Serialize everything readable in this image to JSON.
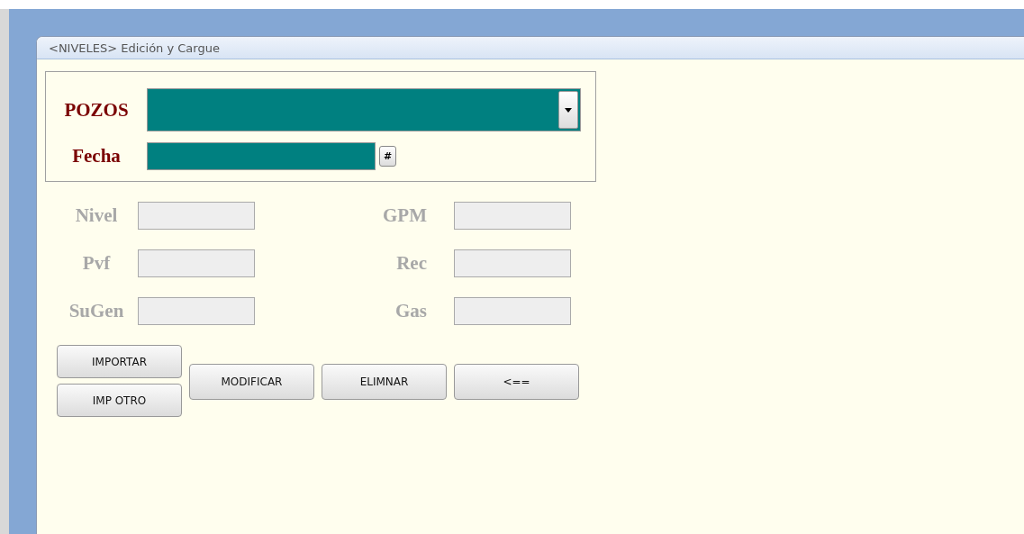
{
  "window": {
    "title": "<NIVELES> Edición y Cargue"
  },
  "selection": {
    "pozos": {
      "label": "POZOS"
    },
    "fecha": {
      "label": "Fecha",
      "button": "#"
    }
  },
  "fields": [
    {
      "label": "Nivel",
      "disabled": true
    },
    {
      "label": "GPM",
      "disabled": true
    },
    {
      "label": "Pvf",
      "disabled": true
    },
    {
      "label": "Rec",
      "disabled": true
    },
    {
      "label": "SuGen",
      "disabled": true
    },
    {
      "label": "Gas",
      "disabled": true
    }
  ],
  "import_buttons": [
    "IMPORTAR",
    "IMP OTRO"
  ],
  "buttons": [
    "MODIFICAR",
    "ELIMNAR",
    "<=="
  ]
}
